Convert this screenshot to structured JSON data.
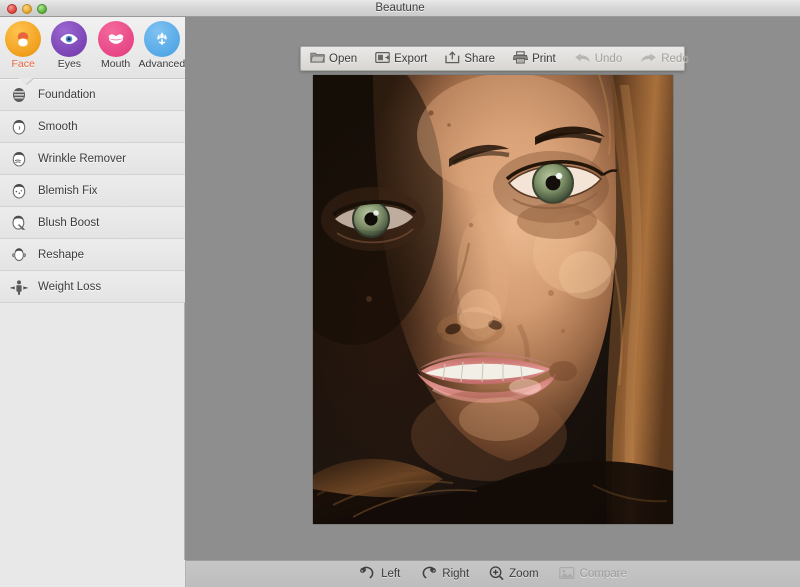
{
  "window": {
    "title": "Beautune",
    "controls": [
      {
        "name": "close",
        "color": "#e0443e"
      },
      {
        "name": "minimize",
        "color": "#e7a52a"
      },
      {
        "name": "zoom",
        "color": "#5cb23d"
      }
    ]
  },
  "sidebar": {
    "categories": [
      {
        "id": "face",
        "label": "Face",
        "icon": "face-icon",
        "color": "#f0a01e",
        "active": true
      },
      {
        "id": "eyes",
        "label": "Eyes",
        "icon": "eye-icon",
        "color": "#7c44b5",
        "active": false
      },
      {
        "id": "mouth",
        "label": "Mouth",
        "icon": "lips-icon",
        "color": "#e84786",
        "active": false
      },
      {
        "id": "advanced",
        "label": "Advanced",
        "icon": "flower-icon",
        "color": "#55a9e6",
        "active": false
      }
    ],
    "active_label_color": "#e8643c",
    "tools": [
      {
        "id": "foundation",
        "label": "Foundation",
        "icon": "face-mask-icon"
      },
      {
        "id": "smooth",
        "label": "Smooth",
        "icon": "face-smooth-icon"
      },
      {
        "id": "wrinkle-remover",
        "label": "Wrinkle Remover",
        "icon": "face-wrinkle-icon"
      },
      {
        "id": "blemish-fix",
        "label": "Blemish Fix",
        "icon": "face-blemish-icon"
      },
      {
        "id": "blush-boost",
        "label": "Blush Boost",
        "icon": "face-blush-icon"
      },
      {
        "id": "reshape",
        "label": "Reshape",
        "icon": "face-reshape-icon"
      },
      {
        "id": "weight-loss",
        "label": "Weight Loss",
        "icon": "body-slim-icon"
      }
    ]
  },
  "top_toolbar": {
    "items": [
      {
        "id": "open",
        "label": "Open",
        "icon": "folder-icon",
        "disabled": false
      },
      {
        "id": "export",
        "label": "Export",
        "icon": "export-icon",
        "disabled": false
      },
      {
        "id": "share",
        "label": "Share",
        "icon": "share-icon",
        "disabled": false
      },
      {
        "id": "print",
        "label": "Print",
        "icon": "printer-icon",
        "disabled": false
      },
      {
        "id": "undo",
        "label": "Undo",
        "icon": "undo-arrow-icon",
        "disabled": true
      },
      {
        "id": "redo",
        "label": "Redo",
        "icon": "redo-arrow-icon",
        "disabled": true
      }
    ]
  },
  "bottom_toolbar": {
    "items": [
      {
        "id": "left",
        "label": "Left",
        "icon": "rotate-left-icon",
        "disabled": false
      },
      {
        "id": "right",
        "label": "Right",
        "icon": "rotate-right-icon",
        "disabled": false
      },
      {
        "id": "zoom",
        "label": "Zoom",
        "icon": "zoom-in-icon",
        "disabled": false
      },
      {
        "id": "compare",
        "label": "Compare",
        "icon": "compare-image-icon",
        "disabled": true
      }
    ]
  },
  "canvas": {
    "background_color": "#8e8e8e",
    "photo": {
      "name": "portrait-photo",
      "description": "Close-up portrait of a smiling young woman with green eyes and brown hair"
    }
  }
}
